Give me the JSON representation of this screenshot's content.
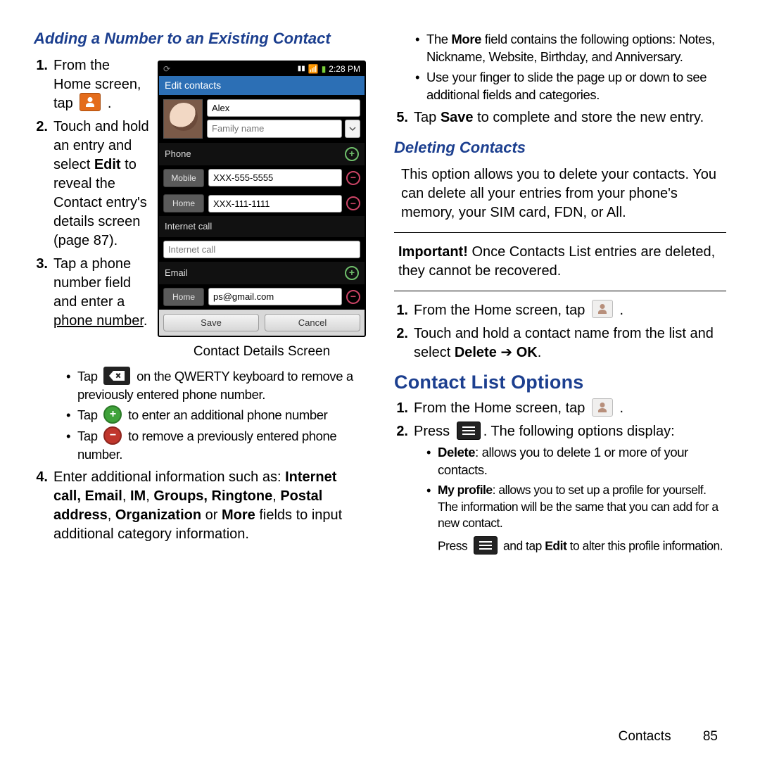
{
  "left": {
    "heading": "Adding a Number to an Existing Contact",
    "step1": "From the Home screen, tap",
    "step2": "Touch and hold an entry and select <b>Edit</b> to reveal the Contact entry's details screen (page 87).",
    "step3": "Tap a phone number field and enter a <u>phone number</u>.",
    "step3_b1_a": "Tap",
    "step3_b1_b": "on the QWERTY keyboard to remove a previously entered phone number.",
    "step3_b2_a": "Tap",
    "step3_b2_b": "to enter an additional phone number",
    "step3_b3_a": "Tap",
    "step3_b3_b": "to remove a previously entered phone number.",
    "step4": "Enter additional information such as: <b>Internet call, Email</b>, <b>IM</b>, <b>Groups, Ringtone</b>, <b>Postal address</b>, <b>Organization</b> or <b>More</b> fields to input additional category information.",
    "caption": "Contact Details Screen"
  },
  "right": {
    "b1": "The <b>More</b> field contains the following options: Notes, Nickname, Website, Birthday, and Anniversary.",
    "b2": "Use your finger to slide the page up or down to see additional fields and categories.",
    "step5": "Tap <b>Save</b> to complete and store the new entry.",
    "del_heading": "Deleting Contacts",
    "del_intro": "This option allows you to delete your contacts. You can delete all your entries from your phone's memory, your SIM card, FDN, or All.",
    "important": "<b>Important!</b> Once Contacts List entries are deleted, they cannot be recovered.",
    "del_s1": "From the Home screen, tap",
    "del_s2": "Touch and hold a contact name from the list and select <b>Delete</b> ➔ <b>OK</b>.",
    "clo_heading": "Contact List Options",
    "clo_s1": "From the Home screen, tap",
    "clo_s2a": "Press",
    "clo_s2b": ". The following options display:",
    "clo_b1": "<b>Delete</b>: allows you to delete 1 or more of your contacts.",
    "clo_b2": "<b>My profile</b>: allows you to set up a profile for yourself. The information will be the same that you can add for a new contact.",
    "clo_sub_a": "Press",
    "clo_sub_b": "and tap <b>Edit</b> to alter this profile information."
  },
  "phone": {
    "time": "2:28 PM",
    "title": "Edit contacts",
    "first_name": "Alex",
    "family_ph": "Family name",
    "sec_phone": "Phone",
    "type_mobile": "Mobile",
    "val_mobile": "XXX-555-5555",
    "type_home": "Home",
    "val_home": "XXX-111-1111",
    "sec_internet": "Internet call",
    "internet_ph": "Internet call",
    "sec_email": "Email",
    "type_email": "Home",
    "val_email": "ps@gmail.com",
    "btn_save": "Save",
    "btn_cancel": "Cancel"
  },
  "footer": {
    "section": "Contacts",
    "page": "85"
  }
}
